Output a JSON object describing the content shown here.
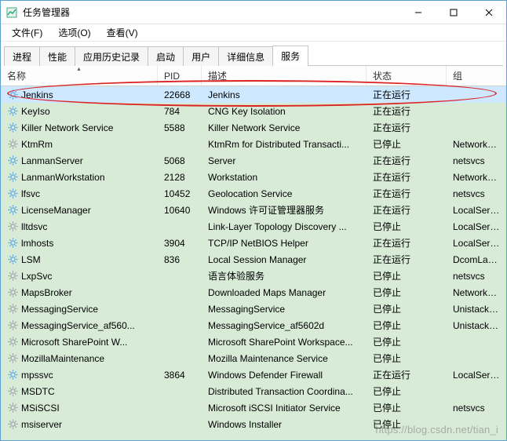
{
  "window": {
    "title": "任务管理器"
  },
  "menus": {
    "file": "文件(F)",
    "options": "选项(O)",
    "view": "查看(V)"
  },
  "tabs": {
    "processes": "进程",
    "performance": "性能",
    "app_history": "应用历史记录",
    "startup": "启动",
    "users": "用户",
    "details": "详细信息",
    "services": "服务"
  },
  "columns": {
    "name": "名称",
    "pid": "PID",
    "desc": "描述",
    "status": "状态",
    "group": "组"
  },
  "status": {
    "running": "正在运行",
    "stopped": "已停止"
  },
  "services": [
    {
      "name": "Jenkins",
      "pid": "22668",
      "desc": "Jenkins",
      "stat": "running",
      "group": "",
      "selected": true
    },
    {
      "name": "KeyIso",
      "pid": "784",
      "desc": "CNG Key Isolation",
      "stat": "running",
      "group": ""
    },
    {
      "name": "Killer Network Service",
      "pid": "5588",
      "desc": "Killer Network Service",
      "stat": "running",
      "group": ""
    },
    {
      "name": "KtmRm",
      "pid": "",
      "desc": "KtmRm for Distributed Transacti...",
      "stat": "stopped",
      "group": "NetworkServ..."
    },
    {
      "name": "LanmanServer",
      "pid": "5068",
      "desc": "Server",
      "stat": "running",
      "group": "netsvcs"
    },
    {
      "name": "LanmanWorkstation",
      "pid": "2128",
      "desc": "Workstation",
      "stat": "running",
      "group": "NetworkServ..."
    },
    {
      "name": "lfsvc",
      "pid": "10452",
      "desc": "Geolocation Service",
      "stat": "running",
      "group": "netsvcs"
    },
    {
      "name": "LicenseManager",
      "pid": "10640",
      "desc": "Windows 许可证管理器服务",
      "stat": "running",
      "group": "LocalService"
    },
    {
      "name": "lltdsvc",
      "pid": "",
      "desc": "Link-Layer Topology Discovery ...",
      "stat": "stopped",
      "group": "LocalService"
    },
    {
      "name": "lmhosts",
      "pid": "3904",
      "desc": "TCP/IP NetBIOS Helper",
      "stat": "running",
      "group": "LocalService..."
    },
    {
      "name": "LSM",
      "pid": "836",
      "desc": "Local Session Manager",
      "stat": "running",
      "group": "DcomLaunch"
    },
    {
      "name": "LxpSvc",
      "pid": "",
      "desc": "语言体验服务",
      "stat": "stopped",
      "group": "netsvcs"
    },
    {
      "name": "MapsBroker",
      "pid": "",
      "desc": "Downloaded Maps Manager",
      "stat": "stopped",
      "group": "NetworkServ..."
    },
    {
      "name": "MessagingService",
      "pid": "",
      "desc": "MessagingService",
      "stat": "stopped",
      "group": "UnistackSvcG..."
    },
    {
      "name": "MessagingService_af560...",
      "pid": "",
      "desc": "MessagingService_af5602d",
      "stat": "stopped",
      "group": "UnistackSvcG..."
    },
    {
      "name": "Microsoft SharePoint W...",
      "pid": "",
      "desc": "Microsoft SharePoint Workspace...",
      "stat": "stopped",
      "group": ""
    },
    {
      "name": "MozillaMaintenance",
      "pid": "",
      "desc": "Mozilla Maintenance Service",
      "stat": "stopped",
      "group": ""
    },
    {
      "name": "mpssvc",
      "pid": "3864",
      "desc": "Windows Defender Firewall",
      "stat": "running",
      "group": "LocalService..."
    },
    {
      "name": "MSDTC",
      "pid": "",
      "desc": "Distributed Transaction Coordina...",
      "stat": "stopped",
      "group": ""
    },
    {
      "name": "MSiSCSI",
      "pid": "",
      "desc": "Microsoft iSCSI Initiator Service",
      "stat": "stopped",
      "group": "netsvcs"
    },
    {
      "name": "msiserver",
      "pid": "",
      "desc": "Windows Installer",
      "stat": "stopped",
      "group": ""
    }
  ],
  "watermark": "https://blog.csdn.net/tian_i"
}
